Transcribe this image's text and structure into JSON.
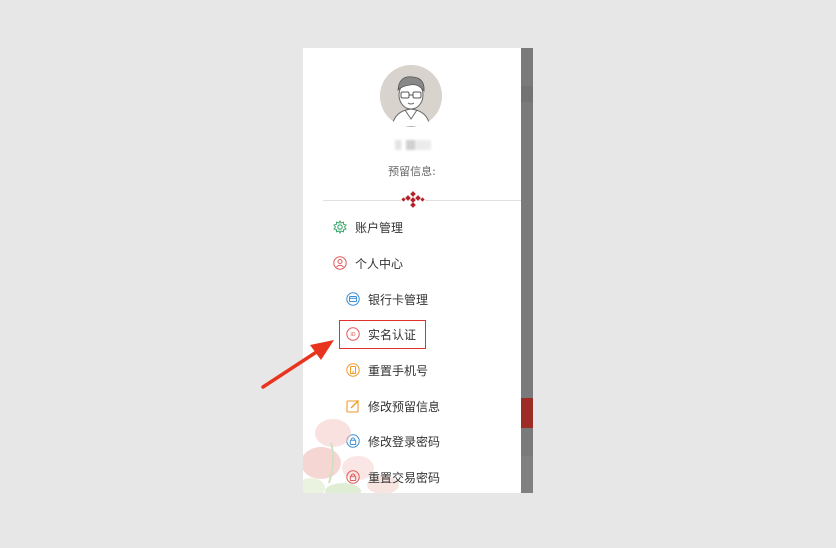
{
  "drawer": {
    "username_blurred": "",
    "reserved_info_label": "预留信息:",
    "menu": [
      {
        "label": "账户管理",
        "icon": "gear-icon",
        "color": "#3aa96a"
      },
      {
        "label": "个人中心",
        "icon": "user-icon",
        "color": "#e05a5a"
      },
      {
        "label": "银行卡管理",
        "icon": "bank-card-icon",
        "color": "#3c8fd6"
      },
      {
        "label": "实名认证",
        "icon": "id-verify-icon",
        "color": "#e05a5a"
      },
      {
        "label": "重置手机号",
        "icon": "phone-icon",
        "color": "#f19a2a"
      },
      {
        "label": "修改预留信息",
        "icon": "edit-icon",
        "color": "#f19a2a"
      },
      {
        "label": "修改登录密码",
        "icon": "lock-icon",
        "color": "#3c8fd6"
      },
      {
        "label": "重置交易密码",
        "icon": "transaction-lock-icon",
        "color": "#e05a5a"
      }
    ]
  },
  "colors": {
    "highlight": "#e0322c",
    "arrow": "#e8341c",
    "accent_red": "#9e2c26"
  }
}
